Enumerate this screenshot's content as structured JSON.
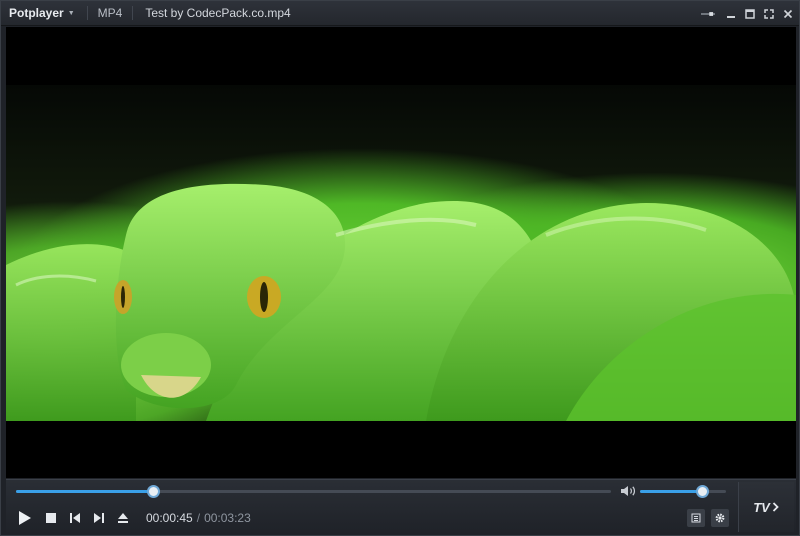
{
  "titlebar": {
    "brand": "Potplayer",
    "format": "MP4",
    "file_title": "Test by CodecPack.co.mp4"
  },
  "window_controls": [
    "pin-icon",
    "minimize-icon",
    "maximize-icon",
    "fullscreen-icon",
    "close-icon"
  ],
  "player": {
    "current_time": "00:00:45",
    "separator": "/",
    "total_time": "00:03:23",
    "seek_fraction": 0.23,
    "volume_fraction": 0.72,
    "tv_label": "TV"
  },
  "playback_buttons": [
    "play-icon",
    "stop-icon",
    "previous-icon",
    "next-icon",
    "eject-icon"
  ],
  "right_buttons": [
    "playlist-icon",
    "settings-icon"
  ],
  "colors": {
    "accent": "#3aa0e8",
    "background": "#1f2228",
    "video_background": "#000000"
  }
}
